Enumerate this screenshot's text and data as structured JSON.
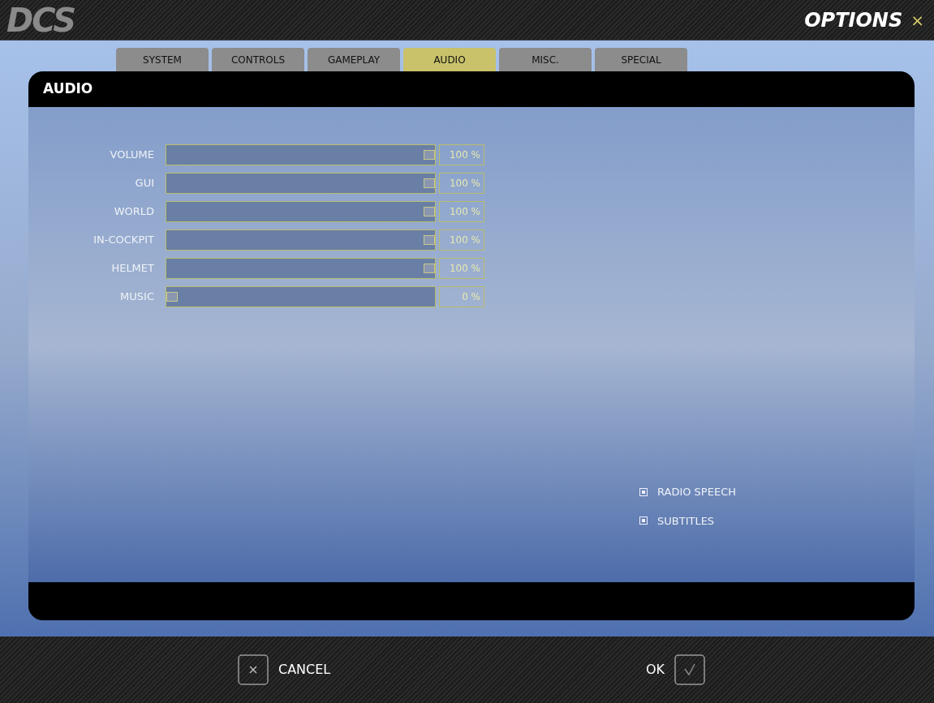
{
  "header": {
    "logo": "DCS",
    "title": "OPTIONS",
    "close": "×"
  },
  "tabs": [
    {
      "label": "SYSTEM",
      "selected": false
    },
    {
      "label": "CONTROLS",
      "selected": false
    },
    {
      "label": "GAMEPLAY",
      "selected": false
    },
    {
      "label": "AUDIO",
      "selected": true
    },
    {
      "label": "MISC.",
      "selected": false
    },
    {
      "label": "SPECIAL",
      "selected": false
    }
  ],
  "panel": {
    "title": "AUDIO"
  },
  "sliders": [
    {
      "name": "VOLUME",
      "level": 1,
      "reading": "100 %"
    },
    {
      "name": "GUI",
      "level": 1,
      "reading": "100 %"
    },
    {
      "name": "WORLD",
      "level": 1,
      "reading": "100 %"
    },
    {
      "name": "IN-COCKPIT",
      "level": 1,
      "reading": "100 %"
    },
    {
      "name": "HELMET",
      "level": 1,
      "reading": "100 %"
    },
    {
      "name": "MUSIC",
      "level": 0,
      "reading": "0 %"
    }
  ],
  "checkboxes": [
    {
      "label": "RADIO SPEECH",
      "checked": true
    },
    {
      "label": "SUBTITLES",
      "checked": true
    }
  ],
  "buttons": [
    {
      "kind": "cancel",
      "label": "CANCEL"
    },
    {
      "kind": "ok",
      "label": "OK"
    }
  ]
}
